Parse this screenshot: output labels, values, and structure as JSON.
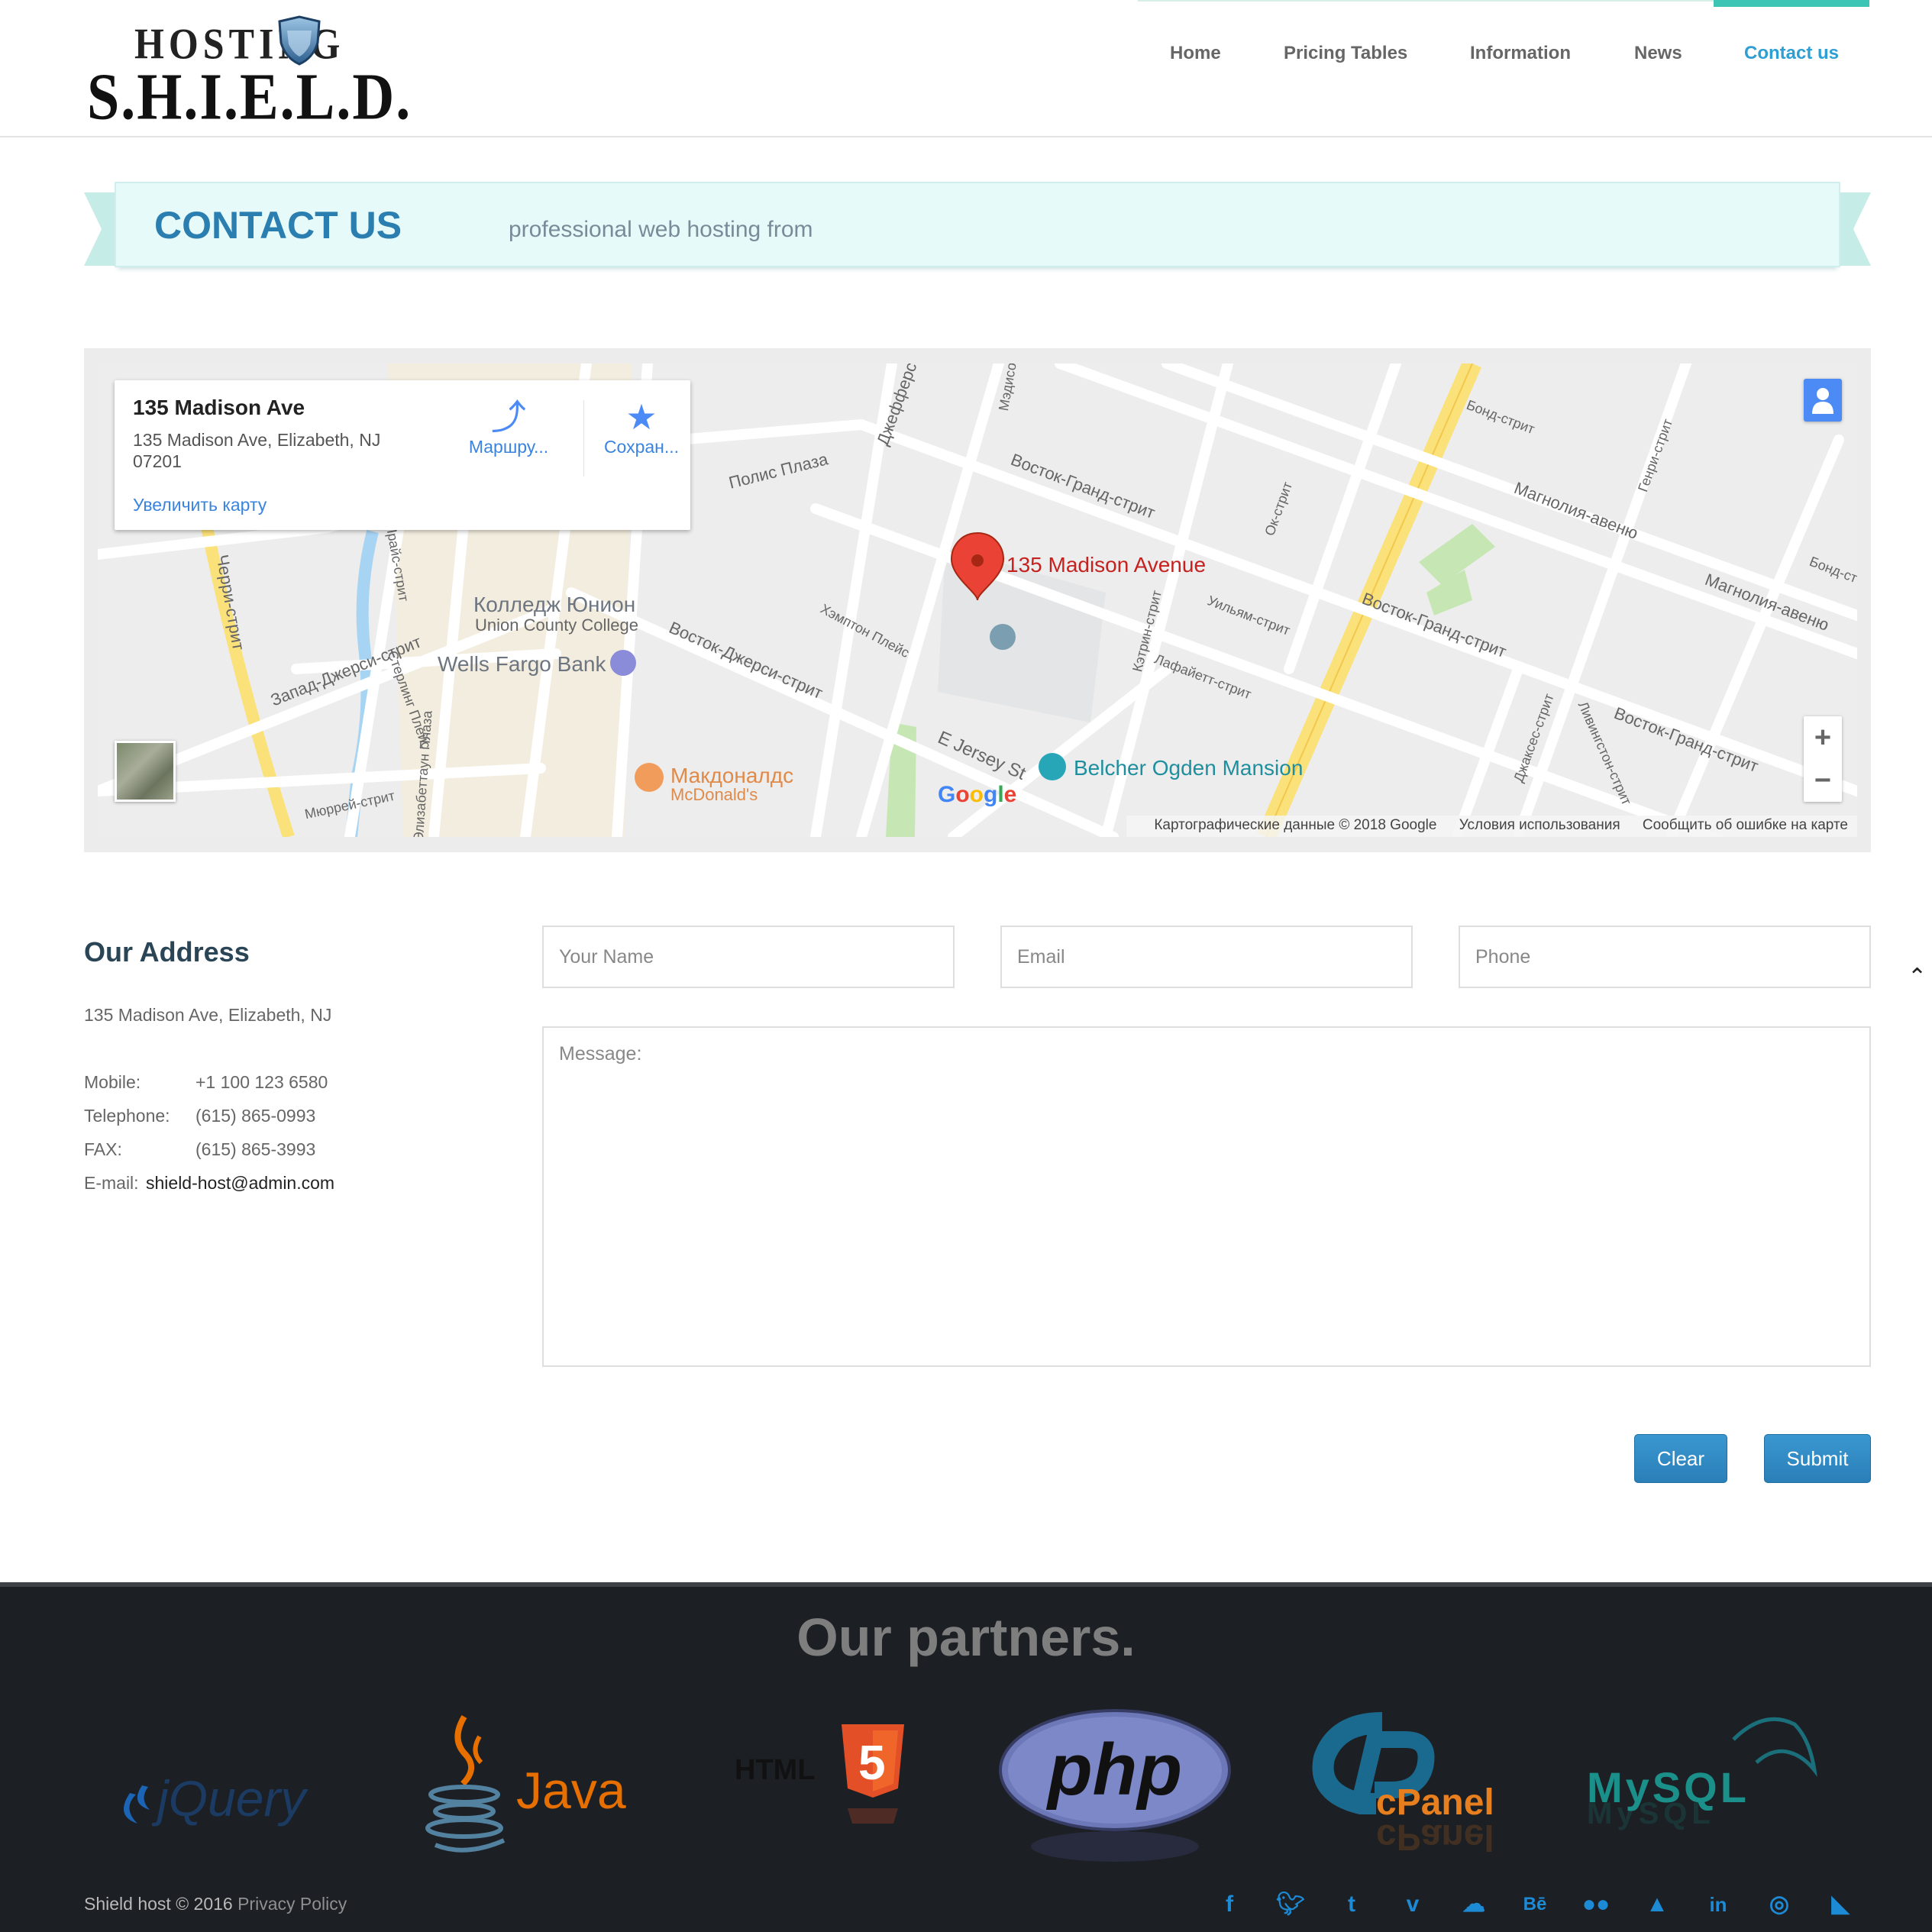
{
  "logo": {
    "line1": "HOSTING",
    "line2": "S.H.I.E.L.D."
  },
  "nav": [
    {
      "label": "Home"
    },
    {
      "label": "Pricing Tables"
    },
    {
      "label": "Information"
    },
    {
      "label": "News"
    },
    {
      "label": "Contact us",
      "active": true
    }
  ],
  "banner": {
    "title": "CONTACT US",
    "subtitle": "professional web hosting from"
  },
  "map": {
    "card": {
      "title": "135 Madison Ave",
      "address": "135 Madison Ave, Elizabeth, NJ 07201",
      "enlarge_link": "Увеличить карту",
      "route_label": "Маршру...",
      "save_label": "Сохран..."
    },
    "pin_label": "135 Madison Avenue",
    "labels": {
      "polis": "Полис Плаза",
      "east_grand_1": "Восток-Гранд-стрит",
      "east_grand_2": "Восток-Гранд-стрит",
      "east_grand_3": "Восток-Гранд-стрит",
      "magnolia_1": "Магнолия-авеню",
      "magnolia_2": "Магнолия-авеню",
      "bond_1": "Бонд-стрит",
      "bond_2": "Бонд-ст",
      "henry": "Генри-стрит",
      "ok": "Ок-стрит",
      "jefferson": "Джефферс",
      "madison": "Мэдисо",
      "college_ru": "Колледж Юнион",
      "college_en": "Union County College",
      "wells": "Wells Fargo Bank",
      "east_jersey": "Восток-Джерси-стрит",
      "hampton": "Хэмптон Плейс",
      "west_jersey": "Запад-Джерси-стрит",
      "cherry": "Черри-стрит",
      "price": "Прайс-стрит",
      "sterling": "Стерлинг Плейс",
      "elizabethtown": "Элизабеттаун Плаза",
      "murray": "Мюррей-стрит",
      "mcd_ru": "Макдоналдс",
      "mcd_en": "McDonald's",
      "e_jersey": "E Jersey St",
      "belcher": "Belcher Ogden Mansion",
      "catherine": "Кэтрин-стрит",
      "william": "Уильям-стрит",
      "lafayette": "Лафайетт-стрит",
      "jackson": "Джаксес-стрит",
      "livingston": "Ливингстон-стрит",
      "zapad": "Запад-"
    },
    "footer": {
      "data": "Картографические данные © 2018 Google",
      "terms": "Условия использования",
      "report": "Сообщить об ошибке на карте"
    }
  },
  "address": {
    "title": "Our Address",
    "line": "135 Madison Ave, Elizabeth, NJ",
    "rows": [
      {
        "label": "Mobile:",
        "value": "+1 100 123 6580"
      },
      {
        "label": "Telephone:",
        "value": "(615) 865-0993"
      },
      {
        "label": "FAX:",
        "value": "(615) 865-3993"
      },
      {
        "label": "E-mail:",
        "value": "shield-host@admin.com"
      }
    ]
  },
  "form": {
    "name_placeholder": "Your Name",
    "email_placeholder": "Email",
    "phone_placeholder": "Phone",
    "message_placeholder": "Message:",
    "clear_label": "Clear",
    "submit_label": "Submit"
  },
  "footer": {
    "partners_title": "Our partners.",
    "partners": [
      "jQuery",
      "Java",
      "HTML",
      "php",
      "cPanel",
      "MySQL"
    ],
    "copyright": "Shield host © 2016",
    "privacy": "Privacy Policy",
    "social": [
      "facebook-icon",
      "twitter-icon",
      "tumblr-icon",
      "vimeo-icon",
      "soundcloud-icon",
      "behance-icon",
      "flickr-icon",
      "delicious-icon",
      "linkedin-icon",
      "dribbble-icon",
      "rss-icon"
    ]
  },
  "colors": {
    "accent_teal": "#3cc4b4",
    "nav_active": "#2d9fd3",
    "banner_bg": "#e6fafa",
    "button_blue": "#2b7fb8",
    "footer_bg": "#1c1f23",
    "social_blue": "#1d8ad6"
  }
}
